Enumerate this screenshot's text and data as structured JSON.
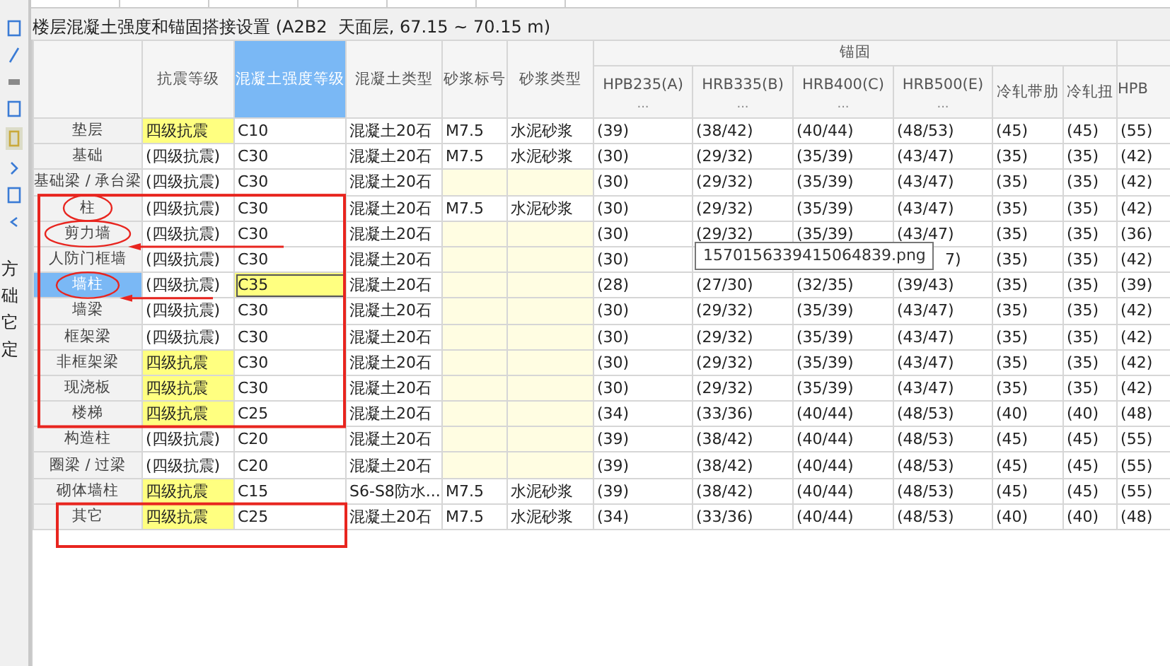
{
  "sidebar": {
    "labels": [
      "方",
      "础",
      "它",
      "定"
    ]
  },
  "title": "楼层混凝土强度和锚固搭接设置 (A2B2  天面层, 67.15 ~ 70.15 m)",
  "table": {
    "group": "锚固",
    "columns": [
      {
        "label": "抗震等级",
        "selected": false
      },
      {
        "label": "混凝土强度等级",
        "selected": true
      },
      {
        "label": "混凝土类型",
        "selected": false
      },
      {
        "label": "砂浆标号",
        "selected": false
      },
      {
        "label": "砂浆类型",
        "selected": false
      }
    ],
    "anchorage_columns": [
      {
        "label": "HPB235(A)",
        "note": "..."
      },
      {
        "label": "HRB335(B)",
        "note": "..."
      },
      {
        "label": "HRB400(C)",
        "note": "..."
      },
      {
        "label": "HRB500(E)",
        "note": "..."
      },
      {
        "label": "冷轧带肋"
      },
      {
        "label": "冷轧扭"
      },
      {
        "label": "HPB"
      }
    ],
    "rows": [
      {
        "name": "垫层",
        "selected": false,
        "seismic": {
          "text": "四级抗震",
          "highlighted": true
        },
        "grade": {
          "text": "C10",
          "current": false
        },
        "concrete_type": "混凝土20石",
        "mortar_grade": "M7.5",
        "mortar_type": "水泥砂浆",
        "anchorage": [
          "(39)",
          "(38/42)",
          "(40/44)",
          "(48/53)",
          "(45)",
          "(45)",
          "(55)"
        ]
      },
      {
        "name": "基础",
        "selected": false,
        "seismic": {
          "text": "(四级抗震)",
          "highlighted": false
        },
        "grade": {
          "text": "C30",
          "current": false
        },
        "concrete_type": "混凝土20石",
        "mortar_grade": "M7.5",
        "mortar_type": "水泥砂浆",
        "anchorage": [
          "(30)",
          "(29/32)",
          "(35/39)",
          "(43/47)",
          "(35)",
          "(35)",
          "(42)"
        ]
      },
      {
        "name": "基础梁 / 承台梁",
        "selected": false,
        "seismic": {
          "text": "(四级抗震)",
          "highlighted": false
        },
        "grade": {
          "text": "C30",
          "current": false
        },
        "concrete_type": "混凝土20石",
        "anchorage": [
          "(30)",
          "(29/32)",
          "(35/39)",
          "(43/47)",
          "(35)",
          "(35)",
          "(42)"
        ]
      },
      {
        "name": "柱",
        "selected": false,
        "seismic": {
          "text": "(四级抗震)",
          "highlighted": false
        },
        "grade": {
          "text": "C30",
          "current": false
        },
        "concrete_type": "混凝土20石",
        "mortar_grade": "M7.5",
        "mortar_type": "水泥砂浆",
        "anchorage": [
          "(30)",
          "(29/32)",
          "(35/39)",
          "(43/47)",
          "(35)",
          "(35)",
          "(42)"
        ]
      },
      {
        "name": "剪力墙",
        "selected": false,
        "seismic": {
          "text": "(四级抗震)",
          "highlighted": false
        },
        "grade": {
          "text": "C30",
          "current": false
        },
        "concrete_type": "混凝土20石",
        "anchorage": [
          "(30)",
          "(29/32)",
          "(35/39)",
          "(43/47)",
          "(35)",
          "(35)",
          "(36)"
        ]
      },
      {
        "name": "人防门框墙",
        "selected": false,
        "seismic": {
          "text": "(四级抗震)",
          "highlighted": false
        },
        "grade": {
          "text": "C30",
          "current": false
        },
        "concrete_type": "混凝土20石",
        "anchorage": [
          {
            "kind": "value",
            "text": "(30)"
          },
          {
            "kind": "covered"
          },
          {
            "kind": "covered"
          },
          {
            "kind": "tail",
            "text": "7)"
          },
          {
            "kind": "value",
            "text": "(35)"
          },
          {
            "kind": "value",
            "text": "(35)"
          },
          {
            "kind": "value",
            "text": "(42)"
          }
        ]
      },
      {
        "name": "墙柱",
        "selected": true,
        "seismic": {
          "text": "(四级抗震)",
          "highlighted": false
        },
        "grade": {
          "text": "C35",
          "current": true
        },
        "concrete_type": "混凝土20石",
        "anchorage": [
          "(28)",
          "(27/30)",
          "(32/35)",
          "(39/43)",
          "(35)",
          "(35)",
          "(39)"
        ]
      },
      {
        "name": "墙梁",
        "selected": false,
        "seismic": {
          "text": "(四级抗震)",
          "highlighted": false
        },
        "grade": {
          "text": "C30",
          "current": false
        },
        "concrete_type": "混凝土20石",
        "anchorage": [
          "(30)",
          "(29/32)",
          "(35/39)",
          "(43/47)",
          "(35)",
          "(35)",
          "(42)"
        ]
      },
      {
        "name": "框架梁",
        "selected": false,
        "seismic": {
          "text": "(四级抗震)",
          "highlighted": false
        },
        "grade": {
          "text": "C30",
          "current": false
        },
        "concrete_type": "混凝土20石",
        "anchorage": [
          "(30)",
          "(29/32)",
          "(35/39)",
          "(43/47)",
          "(35)",
          "(35)",
          "(42)"
        ]
      },
      {
        "name": "非框架梁",
        "selected": false,
        "seismic": {
          "text": "四级抗震",
          "highlighted": true
        },
        "grade": {
          "text": "C30",
          "current": false
        },
        "concrete_type": "混凝土20石",
        "anchorage": [
          "(30)",
          "(29/32)",
          "(35/39)",
          "(43/47)",
          "(35)",
          "(35)",
          "(42)"
        ]
      },
      {
        "name": "现浇板",
        "selected": false,
        "seismic": {
          "text": "四级抗震",
          "highlighted": true
        },
        "grade": {
          "text": "C30",
          "current": false
        },
        "concrete_type": "混凝土20石",
        "anchorage": [
          "(30)",
          "(29/32)",
          "(35/39)",
          "(43/47)",
          "(35)",
          "(35)",
          "(42)"
        ]
      },
      {
        "name": "楼梯",
        "selected": false,
        "seismic": {
          "text": "四级抗震",
          "highlighted": true
        },
        "grade": {
          "text": "C25",
          "current": false
        },
        "concrete_type": "混凝土20石",
        "anchorage": [
          "(34)",
          "(33/36)",
          "(40/44)",
          "(48/53)",
          "(40)",
          "(40)",
          "(48)"
        ]
      },
      {
        "name": "构造柱",
        "selected": false,
        "seismic": {
          "text": "(四级抗震)",
          "highlighted": false
        },
        "grade": {
          "text": "C20",
          "current": false
        },
        "concrete_type": "混凝土20石",
        "anchorage": [
          "(39)",
          "(38/42)",
          "(40/44)",
          "(48/53)",
          "(45)",
          "(45)",
          "(55)"
        ]
      },
      {
        "name": "圈梁 / 过梁",
        "selected": false,
        "seismic": {
          "text": "(四级抗震)",
          "highlighted": false
        },
        "grade": {
          "text": "C20",
          "current": false
        },
        "concrete_type": "混凝土20石",
        "anchorage": [
          "(39)",
          "(38/42)",
          "(40/44)",
          "(48/53)",
          "(45)",
          "(45)",
          "(55)"
        ]
      },
      {
        "name": "砌体墙柱",
        "selected": false,
        "seismic": {
          "text": "四级抗震",
          "highlighted": true
        },
        "grade": {
          "text": "C15",
          "current": false
        },
        "concrete_type": "S6-S8防水...",
        "mortar_grade": "M7.5",
        "mortar_type": "水泥砂浆",
        "anchorage": [
          "(39)",
          "(38/42)",
          "(40/44)",
          "(48/53)",
          "(45)",
          "(45)",
          "(55)"
        ]
      },
      {
        "name": "其它",
        "selected": false,
        "seismic": {
          "text": "四级抗震",
          "highlighted": true
        },
        "grade": {
          "text": "C25",
          "current": false
        },
        "concrete_type": "混凝土20石",
        "mortar_grade": "M7.5",
        "mortar_type": "水泥砂浆",
        "anchorage": [
          "(34)",
          "(33/36)",
          "(40/44)",
          "(48/53)",
          "(40)",
          "(40)",
          "(48)"
        ]
      }
    ]
  },
  "tooltip": {
    "text": "1570156339415064839.png"
  }
}
